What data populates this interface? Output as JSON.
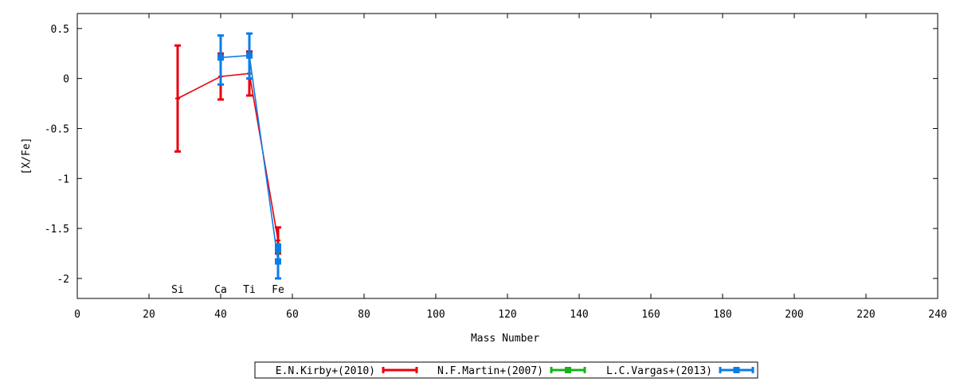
{
  "chart_data": {
    "type": "line",
    "title": "",
    "xlabel": "Mass Number",
    "ylabel": "[X/Fe]",
    "xlim": [
      0,
      240
    ],
    "ylim": [
      -2.2,
      0.65
    ],
    "x_ticks": [
      0,
      20,
      40,
      60,
      80,
      100,
      120,
      140,
      160,
      180,
      200,
      220,
      240
    ],
    "y_ticks": [
      0.5,
      0,
      -0.5,
      -1,
      -1.5,
      -2
    ],
    "y_tick_labels": [
      "0.5",
      "0",
      "-0.5",
      "-1",
      "-1.5",
      "-2"
    ],
    "grid": false,
    "legend_position": "bottom-center",
    "element_labels": [
      {
        "text": "Si",
        "x": 28
      },
      {
        "text": "Ca",
        "x": 40
      },
      {
        "text": "Ti",
        "x": 48
      },
      {
        "text": "Fe",
        "x": 56
      }
    ],
    "series": [
      {
        "name": "E.N.Kirby+(2010)",
        "color": "#e8000b",
        "marker": "none",
        "points": [
          {
            "x": 28,
            "y": -0.2,
            "ylo": -0.73,
            "yhi": 0.33
          },
          {
            "x": 40,
            "y": 0.02,
            "ylo": -0.21,
            "yhi": 0.25
          },
          {
            "x": 48,
            "y": 0.05,
            "ylo": -0.17,
            "yhi": 0.27
          },
          {
            "x": 56,
            "y": -1.62,
            "ylo": -1.75,
            "yhi": -1.49
          }
        ]
      },
      {
        "name": "N.F.Martin+(2007)",
        "color": "#1ab21a",
        "marker": "square",
        "points": [
          {
            "x": 56,
            "y": -1.7,
            "ylo": -1.73,
            "yhi": -1.67
          }
        ]
      },
      {
        "name": "L.C.Vargas+(2013)",
        "color": "#0a7de8",
        "marker": "square",
        "points": [
          {
            "x": 40,
            "y": 0.21,
            "ylo": -0.06,
            "yhi": 0.43
          },
          {
            "x": 48,
            "y": 0.23,
            "ylo": 0.0,
            "yhi": 0.45
          },
          {
            "x": 56,
            "y": -1.83,
            "ylo": -2.0,
            "yhi": -1.66
          },
          {
            "x": 56,
            "y": -1.7,
            "ylo": -1.72,
            "yhi": -1.68
          }
        ]
      }
    ]
  }
}
